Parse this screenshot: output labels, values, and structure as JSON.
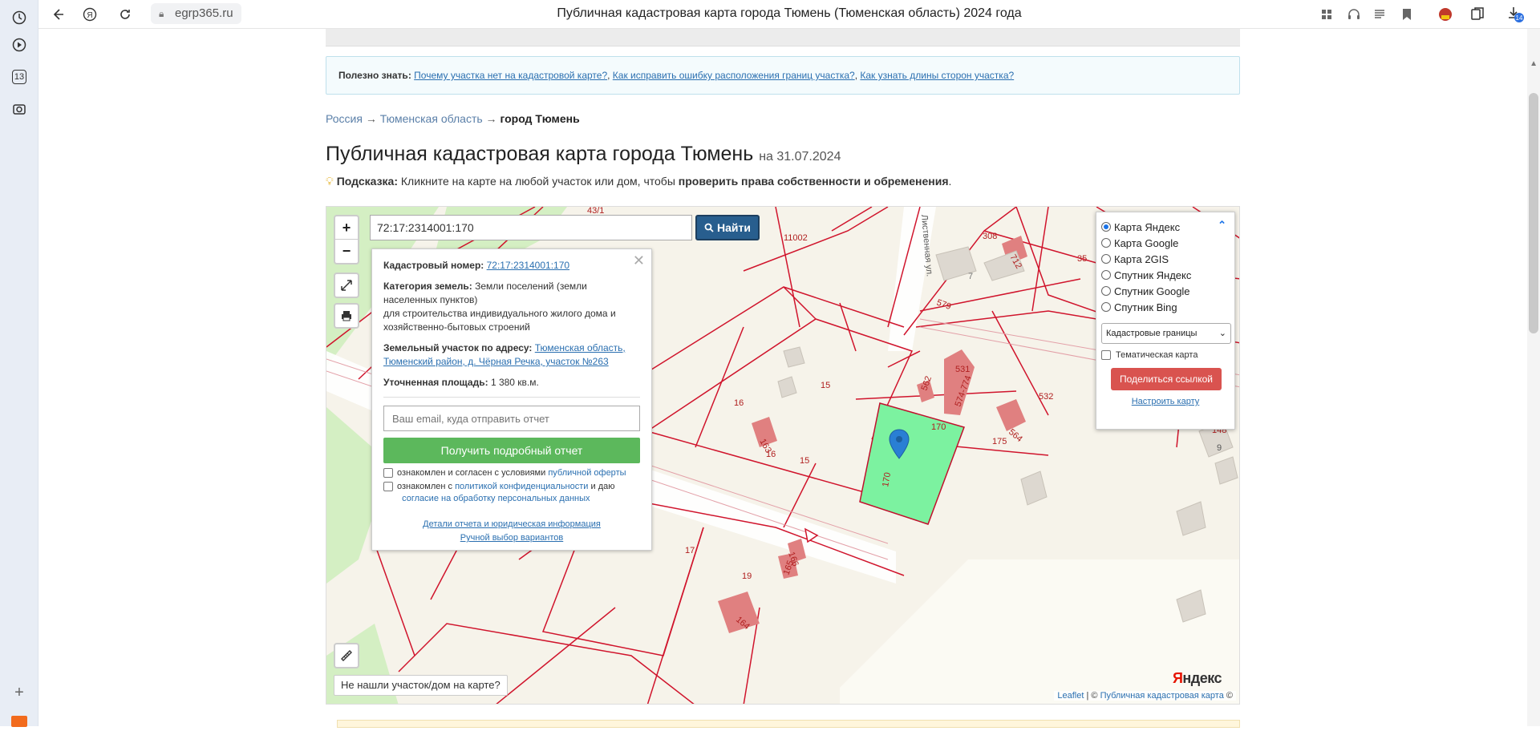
{
  "browser": {
    "url": "egrp365.ru",
    "title": "Публичная кадастровая карта города Тюмень (Тюменская область) 2024 года",
    "rail_badge": "13",
    "downloads_badge": "14"
  },
  "useful": {
    "label": "Полезно знать:",
    "links": [
      "Почему участка нет на кадастровой карте?",
      "Как исправить ошибку расположения границ участка?",
      "Как узнать длины сторон участка?"
    ]
  },
  "breadcrumbs": [
    "Россия",
    "Тюменская область",
    "город Тюмень"
  ],
  "breadcrumb_sep": "→",
  "heading": {
    "title": "Публичная кадастровая карта города Тюмень",
    "date": "на 31.07.2024"
  },
  "hint": {
    "label": "Подсказка:",
    "text": "Кликните на карте на любой участок или дом, чтобы",
    "bold": "проверить права собственности и обременения",
    "end": "."
  },
  "map": {
    "search_value": "72:17:2314001:170",
    "find_label": "Найти",
    "zoom_in": "+",
    "zoom_out": "−",
    "not_found": "Не нашли участок/дом на карте?",
    "attribution_leaflet": "Leaflet",
    "attribution_pkk": "Публичная кадастровая карта",
    "attribution_sep": "| ©",
    "attribution_end": "©",
    "yandex_logo_y": "Я",
    "yandex_logo_rest": "ндекс",
    "labels": [
      "11002",
      "308",
      "712",
      "35",
      "7",
      "579",
      "531",
      "562",
      "574-774",
      "532",
      "564",
      "148",
      "9",
      "16",
      "15",
      "163",
      "16",
      "15",
      "175",
      "170",
      "170",
      "17",
      "166",
      "165",
      "19",
      "164",
      "43/1"
    ],
    "street": "Лиственная ул."
  },
  "popup": {
    "cadastral_label": "Кадастровый номер:",
    "cadastral_value": "72:17:2314001:170",
    "category_label": "Категория земель:",
    "category_value": "Земли поселений (земли населенных пунктов)",
    "usage": "для строительства индивидуального жилого дома и хозяйственно-бытовых строений",
    "address_label": "Земельный участок по адресу:",
    "address_value": "Тюменская область, Тюменский район, д. Чёрная Речка, участок №263",
    "area_label": "Уточненная площадь:",
    "area_value": "1 380 кв.м.",
    "email_placeholder": "Ваш email, куда отправить отчет",
    "report_button": "Получить подробный отчет",
    "consent1_text": "ознакомлен и согласен с условиями",
    "consent1_link": "публичной оферты",
    "consent2_text": "ознакомлен с",
    "consent2_link": "политикой конфиденциальности",
    "consent2_mid": "и даю",
    "consent2_link2": "согласие на обработку персональных данных",
    "details_link": "Детали отчета и юридическая информация",
    "manual_link": "Ручной выбор вариантов"
  },
  "layers": {
    "options": [
      "Карта Яндекс",
      "Карта Google",
      "Карта 2GIS",
      "Спутник Яндекс",
      "Спутник Google",
      "Спутник Bing"
    ],
    "selected": 0,
    "select_value": "Кадастровые границы",
    "thematic": "Тематическая карта",
    "share": "Поделиться ссылкой",
    "configure": "Настроить карту"
  },
  "colors": {
    "accent_red": "#d9534f",
    "accent_green": "#5cb85c",
    "find_blue": "#285e8e",
    "parcel_green": "#7cf2a0",
    "boundary": "#d0142c"
  }
}
